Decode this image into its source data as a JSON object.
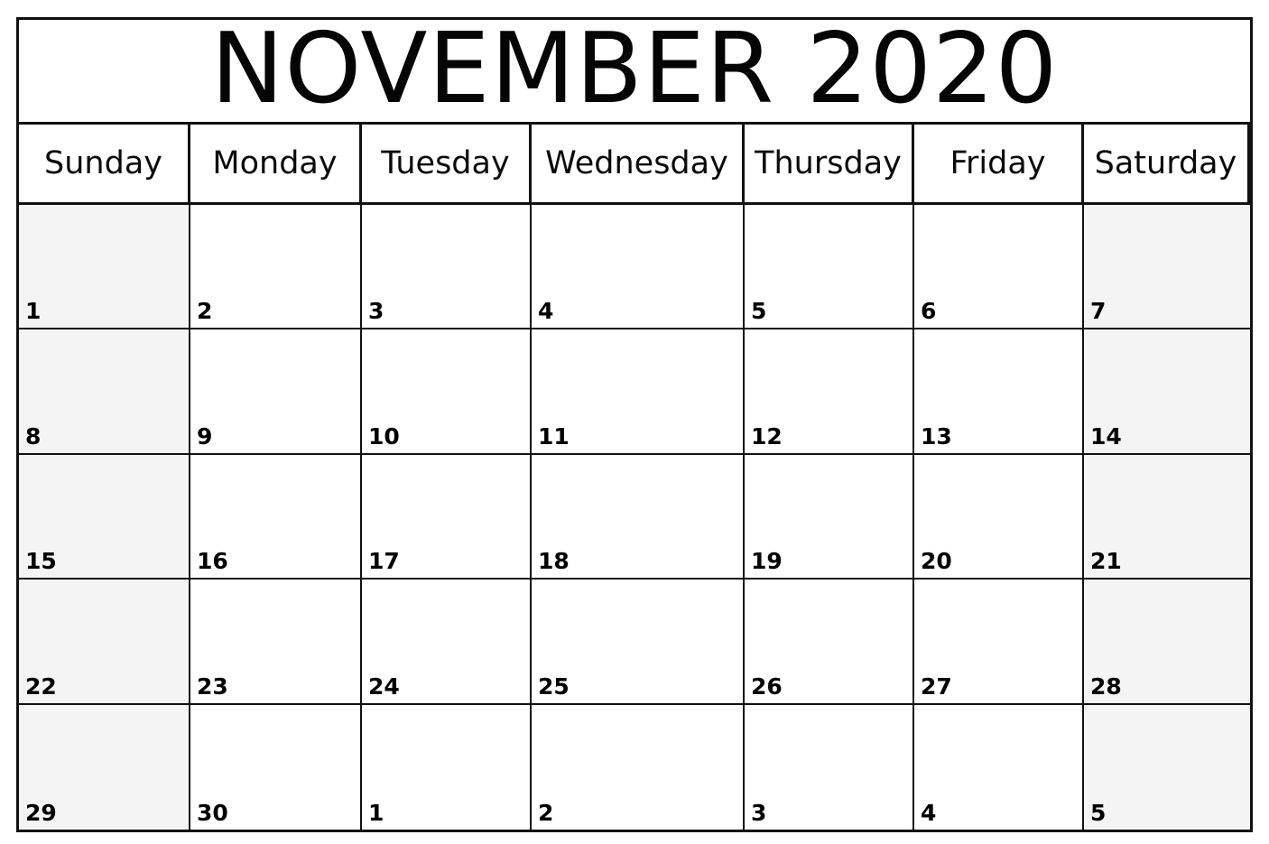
{
  "calendar": {
    "title": "NOVEMBER 2020",
    "month": "November",
    "year": "2020",
    "weekend_background": "#f4f4f4",
    "border_color": "#111111",
    "text_color": "#000000",
    "day_headers": [
      {
        "label": "Sunday"
      },
      {
        "label": "Monday"
      },
      {
        "label": "Tuesday"
      },
      {
        "label": "Wednesday"
      },
      {
        "label": "Thursday"
      },
      {
        "label": "Friday"
      },
      {
        "label": "Saturday"
      }
    ],
    "weeks": [
      {
        "days": [
          {
            "number": "1",
            "weekend": true,
            "other_month": false
          },
          {
            "number": "2",
            "weekend": false,
            "other_month": false
          },
          {
            "number": "3",
            "weekend": false,
            "other_month": false
          },
          {
            "number": "4",
            "weekend": false,
            "other_month": false
          },
          {
            "number": "5",
            "weekend": false,
            "other_month": false
          },
          {
            "number": "6",
            "weekend": false,
            "other_month": false
          },
          {
            "number": "7",
            "weekend": true,
            "other_month": false
          }
        ]
      },
      {
        "days": [
          {
            "number": "8",
            "weekend": true,
            "other_month": false
          },
          {
            "number": "9",
            "weekend": false,
            "other_month": false
          },
          {
            "number": "10",
            "weekend": false,
            "other_month": false
          },
          {
            "number": "11",
            "weekend": false,
            "other_month": false
          },
          {
            "number": "12",
            "weekend": false,
            "other_month": false
          },
          {
            "number": "13",
            "weekend": false,
            "other_month": false
          },
          {
            "number": "14",
            "weekend": true,
            "other_month": false
          }
        ]
      },
      {
        "days": [
          {
            "number": "15",
            "weekend": true,
            "other_month": false
          },
          {
            "number": "16",
            "weekend": false,
            "other_month": false
          },
          {
            "number": "17",
            "weekend": false,
            "other_month": false
          },
          {
            "number": "18",
            "weekend": false,
            "other_month": false
          },
          {
            "number": "19",
            "weekend": false,
            "other_month": false
          },
          {
            "number": "20",
            "weekend": false,
            "other_month": false
          },
          {
            "number": "21",
            "weekend": true,
            "other_month": false
          }
        ]
      },
      {
        "days": [
          {
            "number": "22",
            "weekend": true,
            "other_month": false
          },
          {
            "number": "23",
            "weekend": false,
            "other_month": false
          },
          {
            "number": "24",
            "weekend": false,
            "other_month": false
          },
          {
            "number": "25",
            "weekend": false,
            "other_month": false
          },
          {
            "number": "26",
            "weekend": false,
            "other_month": false
          },
          {
            "number": "27",
            "weekend": false,
            "other_month": false
          },
          {
            "number": "28",
            "weekend": true,
            "other_month": false
          }
        ]
      },
      {
        "days": [
          {
            "number": "29",
            "weekend": true,
            "other_month": false
          },
          {
            "number": "30",
            "weekend": false,
            "other_month": false
          },
          {
            "number": "1",
            "weekend": false,
            "other_month": true
          },
          {
            "number": "2",
            "weekend": false,
            "other_month": true
          },
          {
            "number": "3",
            "weekend": false,
            "other_month": true
          },
          {
            "number": "4",
            "weekend": false,
            "other_month": true
          },
          {
            "number": "5",
            "weekend": true,
            "other_month": true
          }
        ]
      }
    ]
  }
}
